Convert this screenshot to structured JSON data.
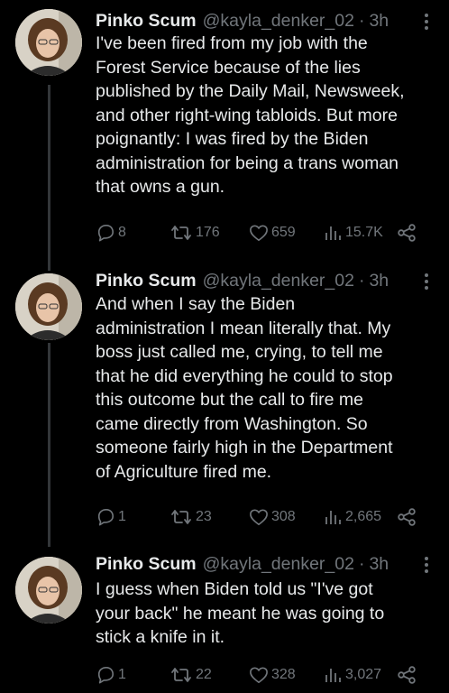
{
  "theme": {
    "background": "#000000",
    "text_color": "#e7e9ea",
    "muted_color": "#71767b",
    "thread_line_color": "#333639"
  },
  "tweets": [
    {
      "author_name": "Pinko Scum",
      "handle": "@kayla_denker_02",
      "separator": "·",
      "time": "3h",
      "text_lines": [
        "I've been fired from my job with the",
        "Forest Service because of the lies",
        "published by the Daily Mail, Newsweek,",
        "and other right-wing tabloids. But more",
        "poignantly: I was fired by the Biden",
        "administration for being a trans woman",
        "that owns a gun."
      ],
      "replies": "8",
      "reposts": "176",
      "likes": "659",
      "views": "15.7K",
      "icons": [
        "reply-icon",
        "repost-icon",
        "like-icon",
        "views-icon",
        "share-icon",
        "more-icon"
      ]
    },
    {
      "author_name": "Pinko Scum",
      "handle": "@kayla_denker_02",
      "separator": "·",
      "time": "3h",
      "text_lines": [
        "And when I say the Biden",
        "administration I mean literally that. My",
        "boss just called me, crying, to tell me",
        "that he did everything he could to stop",
        "this outcome but the call to fire me",
        "came directly from Washington. So",
        "someone fairly high in the Department",
        "of Agriculture fired me."
      ],
      "replies": "1",
      "reposts": "23",
      "likes": "308",
      "views": "2,665",
      "icons": [
        "reply-icon",
        "repost-icon",
        "like-icon",
        "views-icon",
        "share-icon",
        "more-icon"
      ]
    },
    {
      "author_name": "Pinko Scum",
      "handle": "@kayla_denker_02",
      "separator": "·",
      "time": "3h",
      "text_lines": [
        "I guess when Biden told us \"I've got",
        "your back\" he meant he was going to",
        "stick a knife in it."
      ],
      "replies": "1",
      "reposts": "22",
      "likes": "328",
      "views": "3,027",
      "icons": [
        "reply-icon",
        "repost-icon",
        "like-icon",
        "views-icon",
        "share-icon",
        "more-icon"
      ]
    }
  ]
}
